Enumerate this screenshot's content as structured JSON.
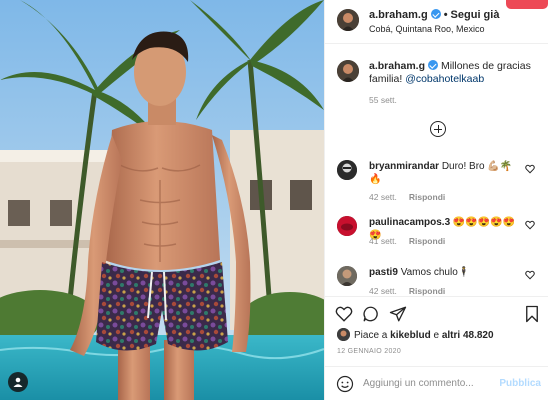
{
  "post": {
    "author": "a.braham.g",
    "follow_label": "Segui già",
    "location": "Cobá, Quintana Roo, Mexico",
    "verified": true,
    "caption_text": "Millones de gracias familia!",
    "caption_mention": "@cobahotelkaab",
    "caption_time": "55 sett.",
    "likes_prefix": "Piace a",
    "likes_user": "kikeblud",
    "likes_mid": "e",
    "likes_count": "altri 48.820",
    "date": "12 GENNAIO 2020"
  },
  "comments": [
    {
      "user": "bryanmirandar",
      "text": "Duro! Bro 💪🏼🌴🔥",
      "time": "42 sett.",
      "reply": "Rispondi"
    },
    {
      "user": "paulinacampos.3",
      "text": "😍😍😍😍😍😍",
      "time": "41 sett.",
      "reply": "Rispondi"
    },
    {
      "user": "pasti9",
      "text": "Vamos chulo🕴",
      "time": "42 sett.",
      "reply": "Rispondi"
    }
  ],
  "add_comment": {
    "placeholder": "Aggiungi un commento...",
    "post_label": "Pubblica"
  },
  "icons": {
    "verified": "verified-badge-icon",
    "load_more": "plus-circle-icon",
    "like": "heart-icon",
    "comment": "comment-icon",
    "share": "paper-plane-icon",
    "save": "bookmark-icon",
    "emoji": "smiley-icon",
    "tag": "user-tag-icon"
  },
  "colors": {
    "link": "#00376b",
    "verified": "#3897f0",
    "muted": "#8e8e8e",
    "post_disabled": "#b3dbff"
  }
}
